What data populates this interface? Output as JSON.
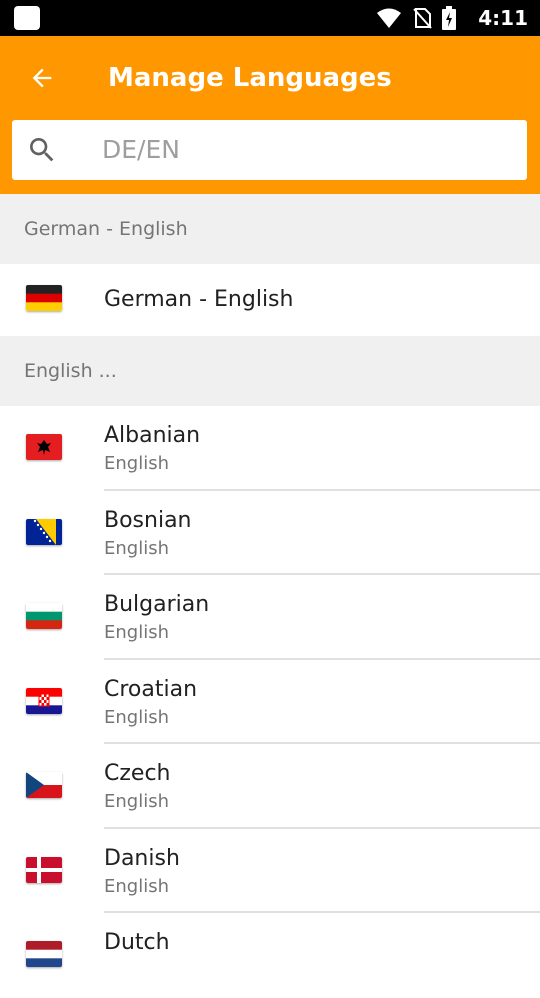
{
  "status_bar": {
    "time": "4:11"
  },
  "app_bar": {
    "title": "Manage Languages",
    "search_placeholder": "DE/EN",
    "accent_color": "#ff9800"
  },
  "sections": [
    {
      "header": "German - English",
      "items": [
        {
          "title": "German - English",
          "flag_icon": "germany-flag-icon"
        }
      ]
    },
    {
      "header": "English ...",
      "items": [
        {
          "title": "Albanian",
          "subtitle": "English",
          "flag_icon": "albania-flag-icon"
        },
        {
          "title": "Bosnian",
          "subtitle": "English",
          "flag_icon": "bosnia-flag-icon"
        },
        {
          "title": "Bulgarian",
          "subtitle": "English",
          "flag_icon": "bulgaria-flag-icon"
        },
        {
          "title": "Croatian",
          "subtitle": "English",
          "flag_icon": "croatia-flag-icon"
        },
        {
          "title": "Czech",
          "subtitle": "English",
          "flag_icon": "czech-flag-icon"
        },
        {
          "title": "Danish",
          "subtitle": "English",
          "flag_icon": "denmark-flag-icon"
        },
        {
          "title": "Dutch",
          "subtitle": "",
          "flag_icon": "netherlands-flag-icon"
        }
      ]
    }
  ]
}
